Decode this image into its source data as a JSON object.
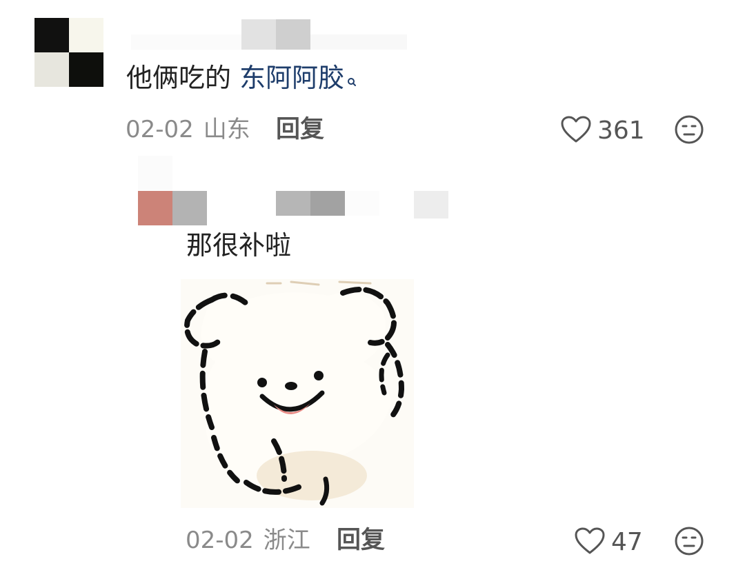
{
  "comment": {
    "text_plain": "他俩吃的 ",
    "text_keyword": "东阿阿胶",
    "keyword_icon": "search-icon",
    "date": "02-02",
    "location": "山东",
    "reply_label": "回复",
    "like_count": "361",
    "like_icon": "heart-outline-icon",
    "emoji_icon": "emoji-face-icon"
  },
  "reply": {
    "text": "那很补啦",
    "sticker": "white-dog-sticker",
    "date": "02-02",
    "location": "浙江",
    "reply_label": "回复",
    "like_count": "47",
    "like_icon": "heart-outline-icon",
    "emoji_icon": "emoji-face-icon"
  },
  "colors": {
    "keyword": "#1e3d6b",
    "meta": "#8a8a8a",
    "action": "#555555"
  }
}
